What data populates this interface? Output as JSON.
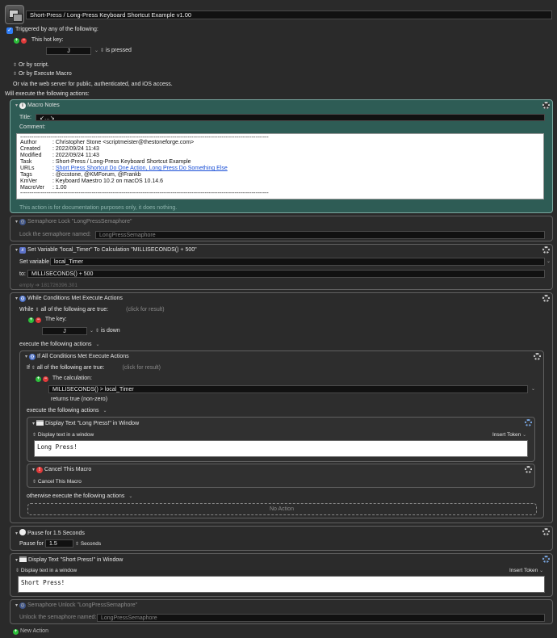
{
  "macro": {
    "name": "Short-Press / Long-Press Keyboard Shortcut Example v1.00",
    "triggered_label": "Triggered by any of the following:",
    "hotkey_label": "This hot key:",
    "hotkey_value": "J",
    "hotkey_state": "is pressed",
    "or_by_script": "Or by script.",
    "or_by_execute_macro": "Or by Execute Macro",
    "or_via_web": "Or via the web server for public, authenticated, and iOS access.",
    "will_execute": "Will execute the following actions:"
  },
  "notes": {
    "header": "Macro Notes",
    "title_label": "Title:",
    "title_value": "↙…↘",
    "comment_label": "Comment:",
    "rule": "------------------------------------------------------------------------------------------------------------------------------------",
    "rows": [
      {
        "k": "Author",
        "v": ":  Christopher Stone <scriptmeister@thestoneforge.com>"
      },
      {
        "k": "Created",
        "v": ":  2022/09/24 11:43"
      },
      {
        "k": "Modified",
        "v": ":  2022/09/24 11:43"
      },
      {
        "k": "Task",
        "v": ":  Short-Press / Long-Press Keyboard Shortcut Example"
      },
      {
        "k": "URLs",
        "v": ":  ",
        "link": "Short Press Shortcut Do One Action, Long Press Do Something Else"
      },
      {
        "k": "Tags",
        "v": ":  @ccstone, @KMForum, @Frankb"
      },
      {
        "k": "KmVer",
        "v": ":  Keyboard Maestro 10.2 on macOS 10.14.6"
      },
      {
        "k": "MacroVer",
        "v": ":  1.00"
      }
    ],
    "footer": "This action is for documentation purposes only, it does nothing."
  },
  "sem_lock": {
    "header": "Semaphore Lock \"LongPressSemaphore\"",
    "label": "Lock the semaphore named:",
    "value": "LongPressSemaphore"
  },
  "set_var": {
    "header": "Set Variable \"local_Timer\" To Calculation \"MILLISECONDS() + 500\"",
    "set_label": "Set variable",
    "var_value": "local_Timer",
    "to_label": "to:",
    "calc_value": "MILLISECONDS() + 500",
    "result": "empty ➔ 181726396.301"
  },
  "while": {
    "header": "While Conditions Met Execute Actions",
    "while_label": "While",
    "cond_mode": "all of the following are true:",
    "click_result": "(click for result)",
    "key_label": "The key:",
    "key_value": "J",
    "key_state": "is down",
    "exec_label": "execute the following actions"
  },
  "ifall": {
    "header": "If All Conditions Met Execute Actions",
    "if_label": "If",
    "cond_mode": "all of the following are true:",
    "click_result": "(click for result)",
    "calc_label": "The calculation:",
    "calc_value": "MILLISECONDS() > local_Timer",
    "returns": "returns true (non-zero)",
    "exec_label": "execute the following actions",
    "otherwise_label": "otherwise execute the following actions",
    "no_action": "No Action"
  },
  "display_long": {
    "header": "Display Text \"Long Press!\" in Window",
    "mode": "Display text in a window",
    "insert_token": "Insert Token",
    "text": "Long Press!"
  },
  "cancel": {
    "header": "Cancel This Macro",
    "mode": "Cancel This Macro"
  },
  "pause": {
    "header": "Pause for 1.5 Seconds",
    "label": "Pause for",
    "value": "1.5",
    "unit": "Seconds"
  },
  "display_short": {
    "header": "Display Text \"Short Press!\" in Window",
    "mode": "Display text in a window",
    "insert_token": "Insert Token",
    "text": "Short Press!"
  },
  "sem_unlock": {
    "header": "Semaphore Unlock \"LongPressSemaphore\"",
    "label": "Unlock the semaphore named:",
    "value": "LongPressSemaphore"
  },
  "new_action": "New Action"
}
